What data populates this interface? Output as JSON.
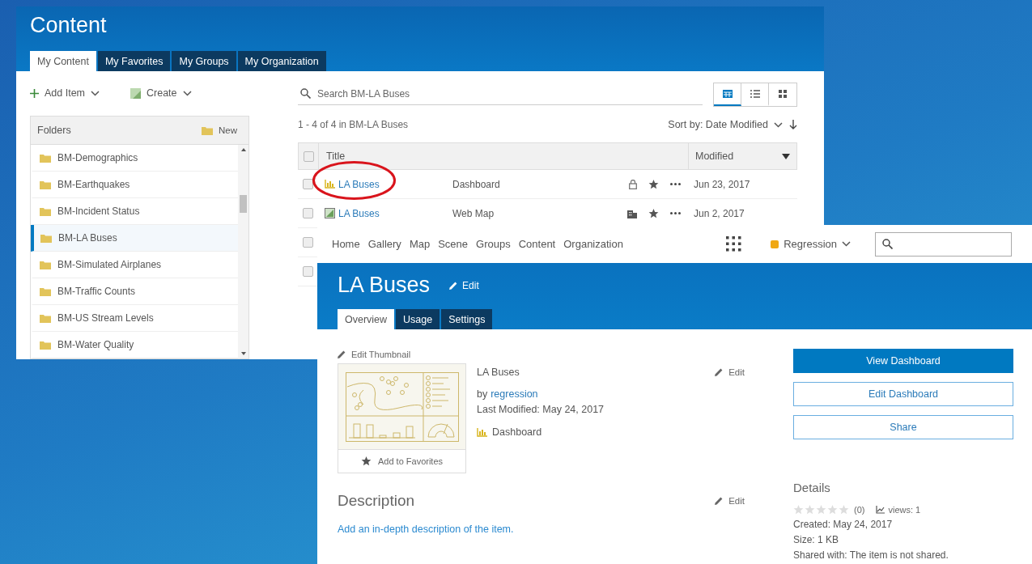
{
  "content_window": {
    "title": "Content",
    "tabs": [
      {
        "label": "My Content",
        "selected": true
      },
      {
        "label": "My Favorites",
        "selected": false
      },
      {
        "label": "My Groups",
        "selected": false
      },
      {
        "label": "My Organization",
        "selected": false
      }
    ],
    "add_item": "Add Item",
    "create": "Create",
    "folders": {
      "header": "Folders",
      "new_label": "New",
      "items": [
        {
          "label": "BM-Demographics",
          "selected": false
        },
        {
          "label": "BM-Earthquakes",
          "selected": false
        },
        {
          "label": "BM-Incident Status",
          "selected": false
        },
        {
          "label": "BM-LA Buses",
          "selected": true
        },
        {
          "label": "BM-Simulated Airplanes",
          "selected": false
        },
        {
          "label": "BM-Traffic Counts",
          "selected": false
        },
        {
          "label": "BM-US Stream Levels",
          "selected": false
        },
        {
          "label": "BM-Water Quality",
          "selected": false
        }
      ]
    },
    "search": {
      "placeholder": "Search BM-LA Buses"
    },
    "view_buttons": [
      {
        "kind": "table",
        "selected": true
      },
      {
        "kind": "list",
        "selected": false
      },
      {
        "kind": "grid",
        "selected": false
      }
    ],
    "result_count": "1 - 4 of 4 in BM-LA Buses",
    "sort_label": "Sort by: Date Modified",
    "table": {
      "columns": [
        "Title",
        "Modified"
      ],
      "all_checked": false,
      "rows": [
        {
          "kind": "dashboard",
          "title": "LA Buses",
          "type": "Dashboard",
          "access": {
            "kind": "private"
          },
          "date": "Jun 23, 2017",
          "checked": false
        },
        {
          "kind": "webmap",
          "title": "LA Buses",
          "type": "Web Map",
          "access": {
            "kind": "organization"
          },
          "date": "Jun 2, 2017",
          "checked": false
        },
        {
          "kind": "hidden",
          "checked": false
        },
        {
          "kind": "hidden",
          "checked": false
        }
      ]
    }
  },
  "item_page": {
    "nav": [
      "Home",
      "Gallery",
      "Map",
      "Scene",
      "Groups",
      "Content",
      "Organization"
    ],
    "account": "Regression",
    "title": "LA Buses",
    "title_edit": "Edit",
    "tabs": [
      {
        "label": "Overview",
        "selected": true
      },
      {
        "label": "Usage",
        "selected": false
      },
      {
        "label": "Settings",
        "selected": false
      }
    ],
    "edit_thumbnail": "Edit Thumbnail",
    "add_to_favorites": "Add to Favorites",
    "item_title": "LA Buses",
    "info_edit": "Edit",
    "by": "by",
    "owner": "regression",
    "last_modified": "Last Modified: May 24, 2017",
    "item_type": "Dashboard",
    "description_heading": "Description",
    "description_edit": "Edit",
    "description_link": "Add an in-depth description of the item.",
    "buttons": [
      {
        "label": "View Dashboard",
        "kind": "primary"
      },
      {
        "label": "Edit Dashboard",
        "kind": "outline"
      },
      {
        "label": "Share",
        "kind": "outline"
      }
    ],
    "details": {
      "heading": "Details",
      "stars": 0,
      "rating_count": "(0)",
      "views": "views: 1",
      "created": "Created: May 24, 2017",
      "size": "Size: 1 KB",
      "shared": "Shared with: The item is not shared."
    }
  }
}
